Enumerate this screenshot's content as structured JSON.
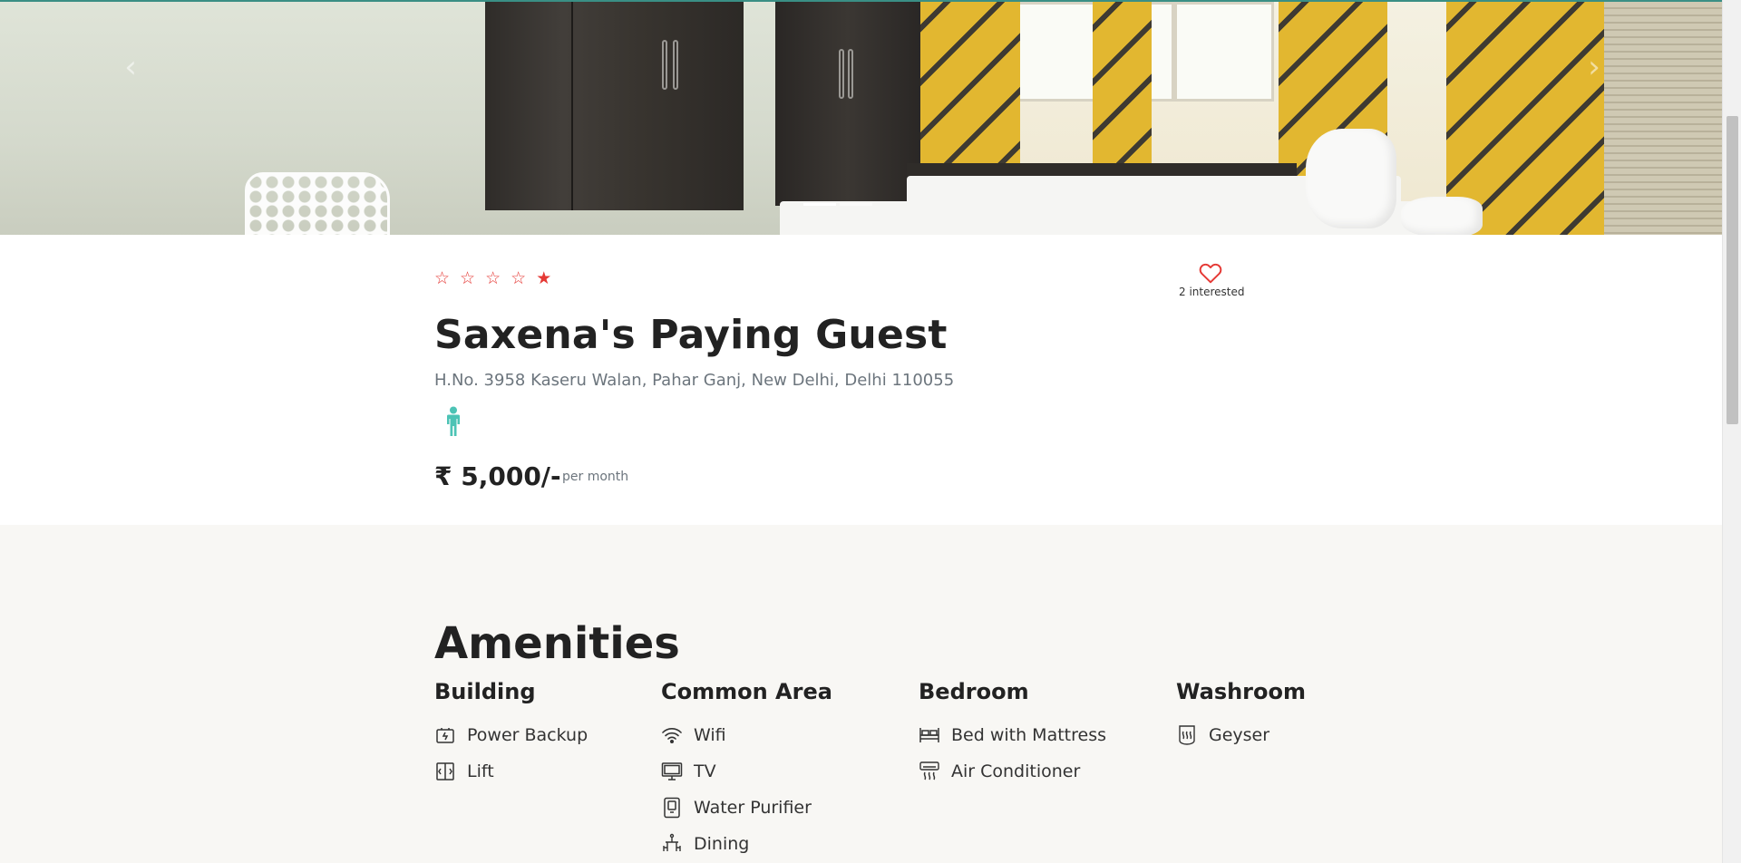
{
  "carousel": {
    "prev_icon": "chevron-left-icon",
    "next_icon": "chevron-right-icon",
    "indicators": [
      true,
      false
    ]
  },
  "listing": {
    "rating_stars": 5,
    "title": "Saxena's Paying Guest",
    "address": "H.No. 3958 Kaseru Walan, Pahar Ganj, New Delhi, Delhi 110055",
    "gender_icon": "male-person-icon",
    "price": "₹ 5,000/-",
    "price_unit": "per month",
    "interested_count": "2 interested"
  },
  "amenities": {
    "title": "Amenities",
    "groups": [
      {
        "title": "Building",
        "items": [
          {
            "label": "Power Backup",
            "icon": "battery-icon"
          },
          {
            "label": "Lift",
            "icon": "elevator-icon"
          }
        ]
      },
      {
        "title": "Common Area",
        "items": [
          {
            "label": "Wifi",
            "icon": "wifi-icon"
          },
          {
            "label": "TV",
            "icon": "tv-icon"
          },
          {
            "label": "Water Purifier",
            "icon": "water-purifier-icon"
          },
          {
            "label": "Dining",
            "icon": "dining-icon"
          }
        ]
      },
      {
        "title": "Bedroom",
        "items": [
          {
            "label": "Bed with Mattress",
            "icon": "bed-icon"
          },
          {
            "label": "Air Conditioner",
            "icon": "air-conditioner-icon"
          }
        ]
      },
      {
        "title": "Washroom",
        "items": [
          {
            "label": "Geyser",
            "icon": "geyser-icon"
          }
        ]
      }
    ]
  },
  "colors": {
    "accent_red": "#e53935",
    "gender_teal": "#4cc3b5",
    "amenities_bg": "#f8f7f4"
  }
}
